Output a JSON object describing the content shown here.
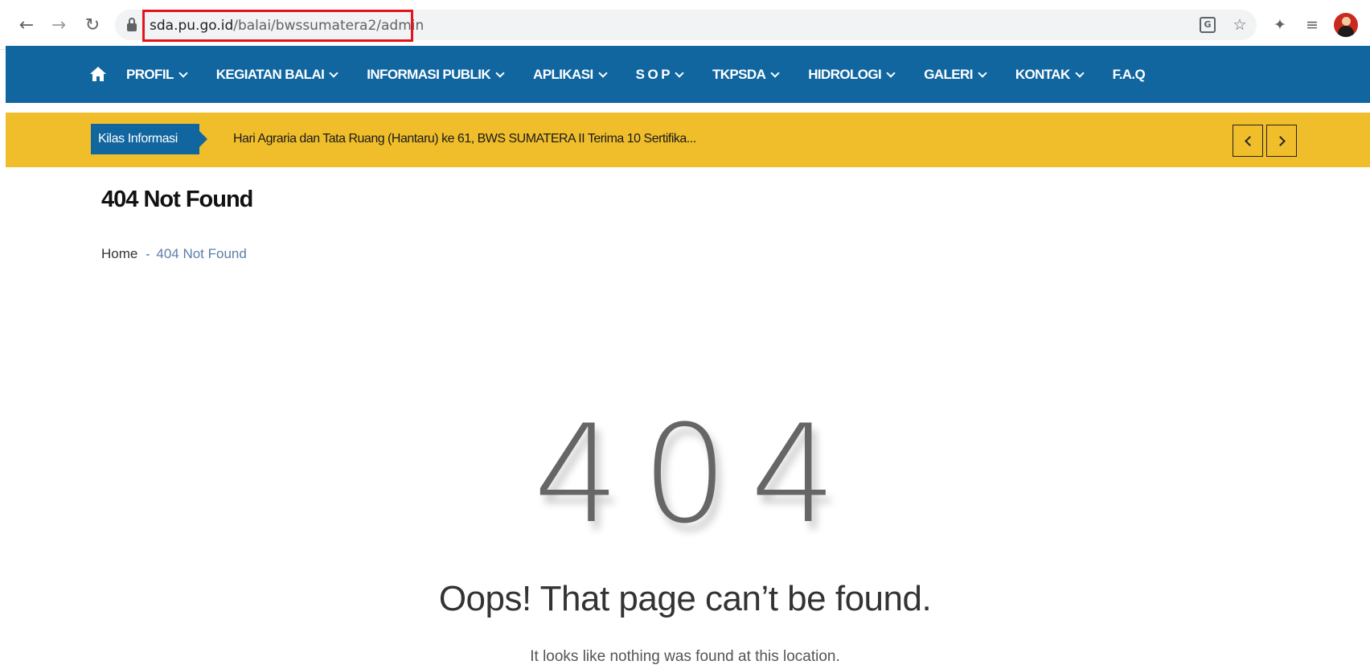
{
  "browser": {
    "url_domain": "sda.pu.go.id",
    "url_path": "/balai/bwssumatera2/admin",
    "icons": [
      "back-arrow-icon",
      "forward-arrow-icon",
      "reload-icon",
      "lock-icon",
      "translate-icon",
      "star-icon",
      "puzzle-icon",
      "reading-list-icon",
      "profile-avatar"
    ]
  },
  "nav": {
    "items": [
      {
        "label": "PROFIL"
      },
      {
        "label": "KEGIATAN BALAI"
      },
      {
        "label": "INFORMASI PUBLIK"
      },
      {
        "label": "APLIKASI"
      },
      {
        "label": "S O P"
      },
      {
        "label": "TKPSDA"
      },
      {
        "label": "HIDROLOGI"
      },
      {
        "label": "GALERI"
      },
      {
        "label": "KONTAK"
      },
      {
        "label": "F.A.Q"
      }
    ]
  },
  "ticker": {
    "label": "Kilas Informasi",
    "text": "Hari Agraria dan Tata Ruang (Hantaru) ke 61, BWS SUMATERA II Terima 10 Sertifika..."
  },
  "page": {
    "title": "404 Not Found",
    "breadcrumb": {
      "home": "Home",
      "separator": "-",
      "current": "404 Not Found"
    }
  },
  "error": {
    "code": "404",
    "heading": "Oops! That page can’t be found.",
    "message": "It looks like nothing was found at this location."
  },
  "colors": {
    "nav_bg": "#1166a0",
    "ticker_bg": "#f0be2b",
    "url_highlight": "#e3141c"
  }
}
